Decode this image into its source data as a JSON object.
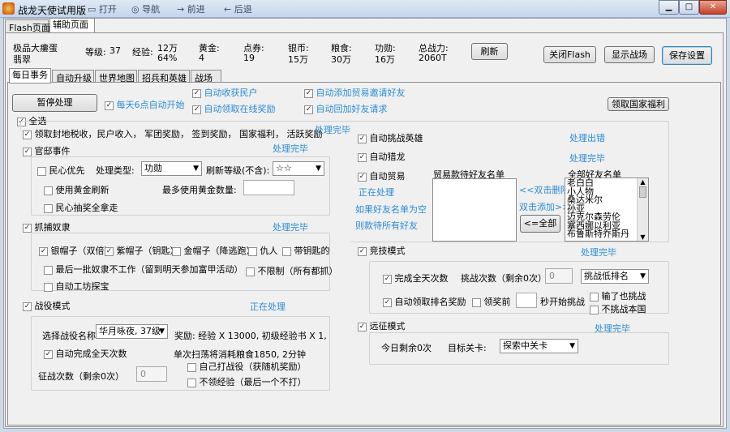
{
  "window": {
    "title": "战龙天使试用版",
    "toolbar": [
      "打开",
      "导航",
      "前进",
      "后退"
    ]
  },
  "outer_tabs": [
    "Flash页面",
    "辅助页面"
  ],
  "stats": [
    {
      "label": "极品大瘻蛋",
      "value": "翡翠"
    },
    {
      "label": "等级:",
      "value": "37"
    },
    {
      "label": "经验:",
      "value": "12万",
      "value2": "64%"
    },
    {
      "label": "黄金:",
      "value": "4"
    },
    {
      "label": "点券:",
      "value": "19"
    },
    {
      "label": "银币:",
      "value": "15万"
    },
    {
      "label": "粮食:",
      "value": "30万"
    },
    {
      "label": "功勋:",
      "value": "16万"
    },
    {
      "label": "总战力:",
      "value": "2060T"
    }
  ],
  "buttons": {
    "refresh": "刷新",
    "close_flash": "关闭Flash",
    "show_battle": "显示战场",
    "save": "保存设置",
    "pause": "暂停处理",
    "national": "领取国家福利",
    "all": "<=全部"
  },
  "inner_tabs": [
    "每日事务",
    "自动升级",
    "世界地图",
    "招兵和英雄",
    "战场"
  ],
  "top_checks": {
    "daily6": "每天6点自动开始",
    "harvest": "自动收获民户",
    "online": "自动领取在线奖励",
    "trade_invite": "自动添加贸易邀请好友",
    "reply_friend": "自动回加好友请求"
  },
  "all": "全选",
  "collect": {
    "label": "领取封地税收，民户收入， 军团奖励， 签到奖励， 国家福利， 活跃奖励",
    "status": "处理完毕"
  },
  "mansion": {
    "label": "官邸事件",
    "status": "处理完毕",
    "people_first": "民心优先",
    "type_label": "处理类型:",
    "type_value": "功勋",
    "level_label": "刷新等级(不含):",
    "level_value": "☆☆",
    "use_gold": "使用黄金刷新",
    "max_gold": "最多使用黄金数量:",
    "full_reward": "民心抽奖全拿走"
  },
  "slave": {
    "label": "抓捕奴隶",
    "status": "处理完毕",
    "opts": [
      "银帽子（双倍）",
      "紫帽子（钥匙）",
      "金帽子（降逃跑）",
      "仇人",
      "带钥匙的"
    ],
    "last_batch": "最后一批奴隶不工作（留到明天参加富甲活动）",
    "no_limit": "不限制（所有都抓）",
    "workshop": "自动工坊探宝"
  },
  "campaign": {
    "label": "战役模式",
    "status": "正在处理",
    "select_label": "选择战役名称",
    "select_value": "华月咏夜, 37级",
    "reward": "奖励:  经验 X 13000, 初级经验书 X 1, ",
    "complete": "自动完成全天次数",
    "sweep": "单次扫荡将消耗粮食1850, 2分钟",
    "self_fight": "自己打战役（获随机奖励）",
    "count_label": "征战次数（剩余0次）",
    "count_value": "0",
    "no_exp": "不领经验（最后一个不打）"
  },
  "right": {
    "hero": "自动挑战英雄",
    "hero_status": "处理出错",
    "dragon": "自动猎龙",
    "dragon_status": "处理完毕",
    "trade": "自动贸易",
    "trade_status": "正在处理",
    "trade_list_title": "贸易款待好友名单",
    "all_list_title": "全部好友名单",
    "dbl_del": "<<双击删除",
    "dbl_add": "双击添加>>",
    "note1": "如果好友名单为空",
    "note2": "则款待所有好友",
    "friends": [
      "老白白",
      "小人物",
      "桑达米尔",
      "孙亚",
      "迈克尔森劳伦",
      "塞西娜以利亚",
      "布鲁斯特乔斯丹"
    ],
    "arena": "竞技模式",
    "arena_status": "处理完毕",
    "full_day": "完成全天次数",
    "challenge_label": "挑战次数（剩余0次）",
    "challenge_value": "0",
    "rank_select": "挑战低排名",
    "lose_ok": "输了也挑战",
    "rank_reward": "自动领取排名奖励",
    "before": "领奖前",
    "sec": "秒开始挑战",
    "no_country": "不挑战本国",
    "expedition": "远征模式",
    "exp_status": "处理完毕",
    "remain": "今日剩余0次",
    "target_label": "目标关卡:",
    "target_value": "探索中关卡"
  }
}
